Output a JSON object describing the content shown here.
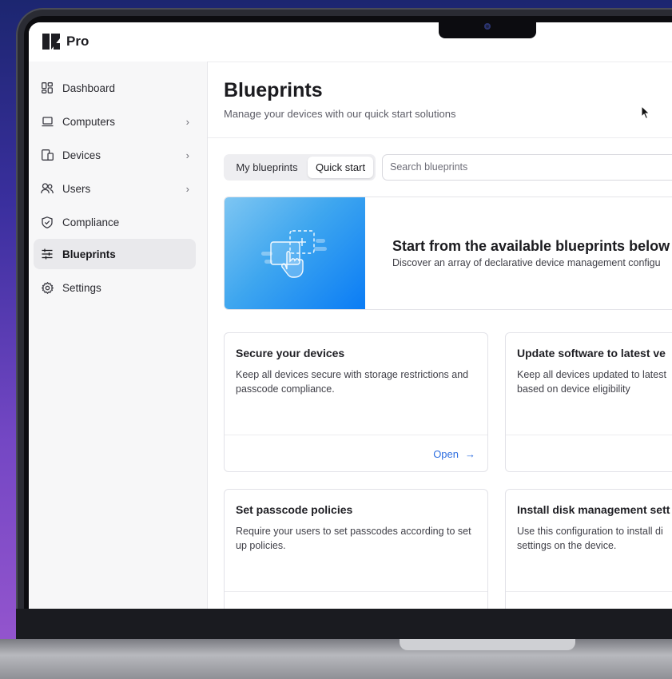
{
  "app": {
    "name": "Pro"
  },
  "sidebar": {
    "items": [
      {
        "label": "Dashboard",
        "icon": "dashboard-icon",
        "chevron": false,
        "active": false
      },
      {
        "label": "Computers",
        "icon": "laptop-icon",
        "chevron": true,
        "active": false
      },
      {
        "label": "Devices",
        "icon": "devices-icon",
        "chevron": true,
        "active": false
      },
      {
        "label": "Users",
        "icon": "users-icon",
        "chevron": true,
        "active": false
      },
      {
        "label": "Compliance",
        "icon": "shield-check-icon",
        "chevron": false,
        "active": false
      },
      {
        "label": "Blueprints",
        "icon": "sliders-icon",
        "chevron": false,
        "active": true
      },
      {
        "label": "Settings",
        "icon": "gear-icon",
        "chevron": false,
        "active": false
      }
    ]
  },
  "page": {
    "title": "Blueprints",
    "subtitle": "Manage your devices with our quick start solutions"
  },
  "tabs": {
    "my": "My blueprints",
    "quick": "Quick start",
    "selected": "Quick start"
  },
  "search": {
    "placeholder": "Search blueprints"
  },
  "hero": {
    "title": "Start from the available blueprints below",
    "description": "Discover an array of declarative device management configu"
  },
  "cards": [
    {
      "title": "Secure your devices",
      "description": "Keep all devices secure with storage restrictions and passcode compliance.",
      "action": "Open"
    },
    {
      "title": "Update software to latest ve",
      "description": "Keep all devices updated to latest based on device eligibility",
      "action": ""
    },
    {
      "title": "Set passcode policies",
      "description": "Require your users to set passcodes according to set up policies.",
      "action": ""
    },
    {
      "title": "Install disk management sett",
      "description": "Use this configuration to install di settings on the device.",
      "action": ""
    }
  ],
  "colors": {
    "accent": "#2f6fe0",
    "hero_start": "#7ec6f2",
    "hero_end": "#0a7cf5"
  }
}
